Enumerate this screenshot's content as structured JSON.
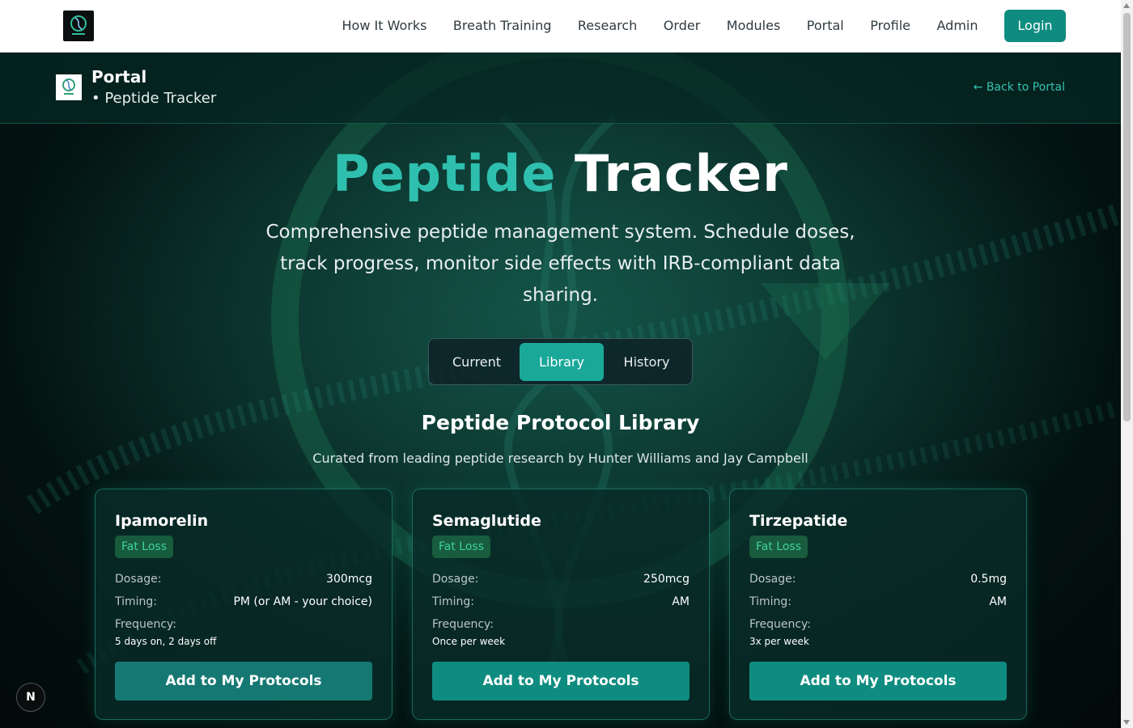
{
  "nav": {
    "links": [
      "How It Works",
      "Breath Training",
      "Research",
      "Order",
      "Modules",
      "Portal",
      "Profile",
      "Admin"
    ],
    "login_label": "Login"
  },
  "subheader": {
    "title": "Portal",
    "subtitle": "• Peptide Tracker",
    "back_label": "← Back to Portal"
  },
  "hero": {
    "title_accent": "Peptide",
    "title_rest": "Tracker",
    "description": "Comprehensive peptide management system. Schedule doses, track progress, monitor side effects with IRB-compliant data sharing."
  },
  "tabs": {
    "current": "Current",
    "library": "Library",
    "history": "History",
    "active": "Library"
  },
  "library": {
    "title": "Peptide Protocol Library",
    "subtitle": "Curated from leading peptide research by Hunter Williams and Jay Campbell"
  },
  "labels": {
    "dosage": "Dosage:",
    "timing": "Timing:",
    "frequency": "Frequency:"
  },
  "cards": [
    {
      "name": "Ipamorelin",
      "category": "Fat Loss",
      "dosage": "300mcg",
      "timing": "PM (or AM - your choice)",
      "frequency": "5 days on, 2 days off",
      "button": "Add to My Protocols"
    },
    {
      "name": "Semaglutide",
      "category": "Fat Loss",
      "dosage": "250mcg",
      "timing": "AM",
      "frequency": "Once per week",
      "button": "Add to My Protocols"
    },
    {
      "name": "Tirzepatide",
      "category": "Fat Loss",
      "dosage": "0.5mg",
      "timing": "AM",
      "frequency": "3x per week",
      "button": "Add to My Protocols"
    }
  ],
  "corner_badge": "N",
  "colors": {
    "accent": "#1aa899",
    "button": "#0f8c80",
    "title_accent": "#2fbfae",
    "badge_text": "#3fd0a0",
    "link": "#33c2b0"
  }
}
